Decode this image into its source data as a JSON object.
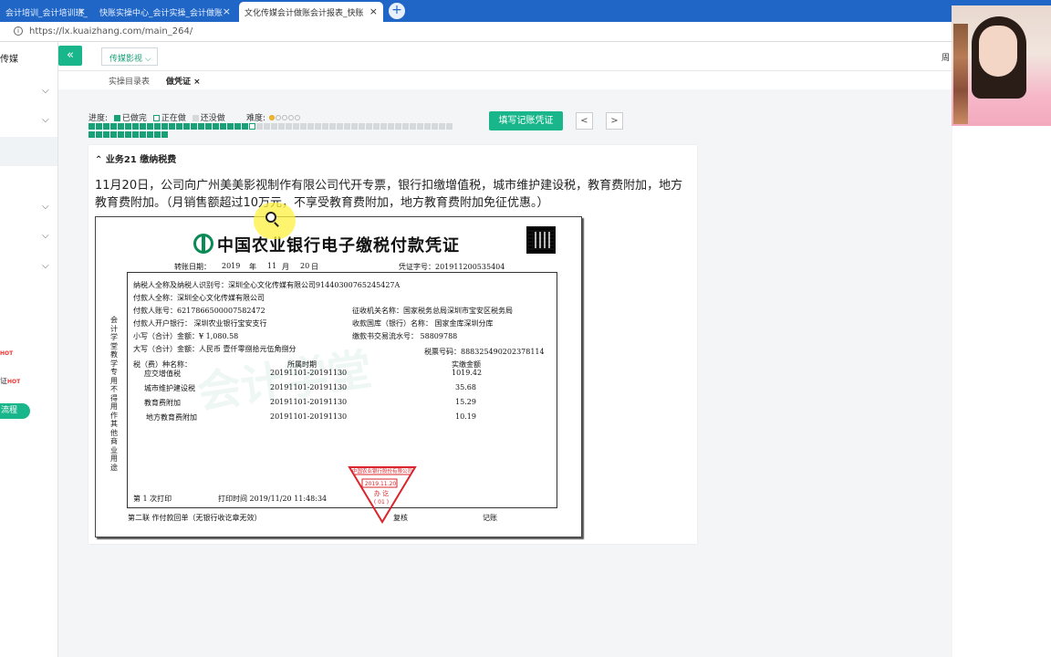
{
  "browser": {
    "tabs": [
      {
        "label": "会计培训_会计培训班_",
        "active": false
      },
      {
        "label": "快账实操中心_会计实操_会计做账",
        "active": false
      },
      {
        "label": "文化传媒会计做账会计报表_快账",
        "active": true
      }
    ],
    "url": "https://lx.kuaizhang.com/main_264/"
  },
  "sidebar": {
    "title": "传媒",
    "hot1": "证",
    "hot_badge": "HOT",
    "flow_button": "流程"
  },
  "header": {
    "dropdown": "传媒影视",
    "right_cut": "周"
  },
  "subtabs": [
    {
      "label": "实操目录表",
      "active": false
    },
    {
      "label": "做凭证",
      "active": true,
      "close": "×"
    }
  ],
  "progress": {
    "label": "进度:",
    "legend_done": "已做完",
    "legend_doing": "正在做",
    "legend_todo": "还没做",
    "difficulty_label": "难度:",
    "difficulty_level": 1,
    "difficulty_max": 5,
    "done_count": 22,
    "current_index": 22,
    "row1_total": 60,
    "row2_total": 10
  },
  "actions": {
    "fill_button": "填写记账凭证",
    "prev": "<",
    "next": ">"
  },
  "task": {
    "title": "业务21 缴纳税费",
    "description": "11月20日，公司向广州美美影视制作有限公司代开专票，银行扣缴增值税，城市维护建设税，教育费附加，地方教育费附加。（月销售额超过10万元，不享受教育费附加，地方教育费附加免征优惠。）"
  },
  "voucher": {
    "title": "中国农业银行电子缴税付款凭证",
    "transfer_date_label": "转账日期：",
    "year": "2019",
    "year_unit": "年",
    "month": "11",
    "month_unit": "月",
    "day": "20",
    "day_unit": "日",
    "voucher_no": "凭证字号：201911200535404",
    "taxpayer": "纳税人全称及纳税人识别号：深圳全心文化传媒有限公司91440300765245427A",
    "payer_name": "付款人全称：深圳全心文化传媒有限公司",
    "payer_account": "付款人账号：6217866500007582472",
    "collector": "征收机关名称：国家税务总局深圳市宝安区税务局",
    "payer_bank": "付款人开户银行：  深圳农业银行宝安支行",
    "treasury": "收款国库（银行）名称：  国家金库深圳分库",
    "amount_small": "小写（合计）金额：¥  1,080.58",
    "serial": "缴款书交易流水号：  58809788",
    "amount_big": "大写（合计）金额：人民币 壹仟零捌拾元伍角捌分",
    "ticket_no": "税票号码：888325490202378114",
    "col_type": "税（费）种名称：",
    "col_period": "所属时期",
    "col_amount": "实缴金额",
    "rows": [
      {
        "name": "应交增值税",
        "period": "20191101-20191130",
        "amount": "1019.42"
      },
      {
        "name": "城市维护建设税",
        "period": "20191101-20191130",
        "amount": "35.68"
      },
      {
        "name": "教育费附加",
        "period": "20191101-20191130",
        "amount": "15.29"
      },
      {
        "name": "地方教育费附加",
        "period": "20191101-20191130",
        "amount": "10.19"
      }
    ],
    "print_count": "第    1    次打印",
    "print_time": "打印时间 2019/11/20 11:48:34",
    "footer_left": "第二联  作付款回单（无银行收讫章无效）",
    "footer_review": "复核",
    "footer_book": "记账",
    "side_text": "会计学堂教学专用 不得用作其他商业用途",
    "stamp_bank": "中国农业银行股份有限公司",
    "stamp_date": "2019.11.20",
    "stamp_action": "办  讫",
    "stamp_num": "( 01 )"
  },
  "colors": {
    "brand_green": "#19b68b",
    "tab_blue": "#1f66c7",
    "done": "#19a077",
    "todo": "#d5d9dc",
    "stamp_red": "#d9252b"
  }
}
